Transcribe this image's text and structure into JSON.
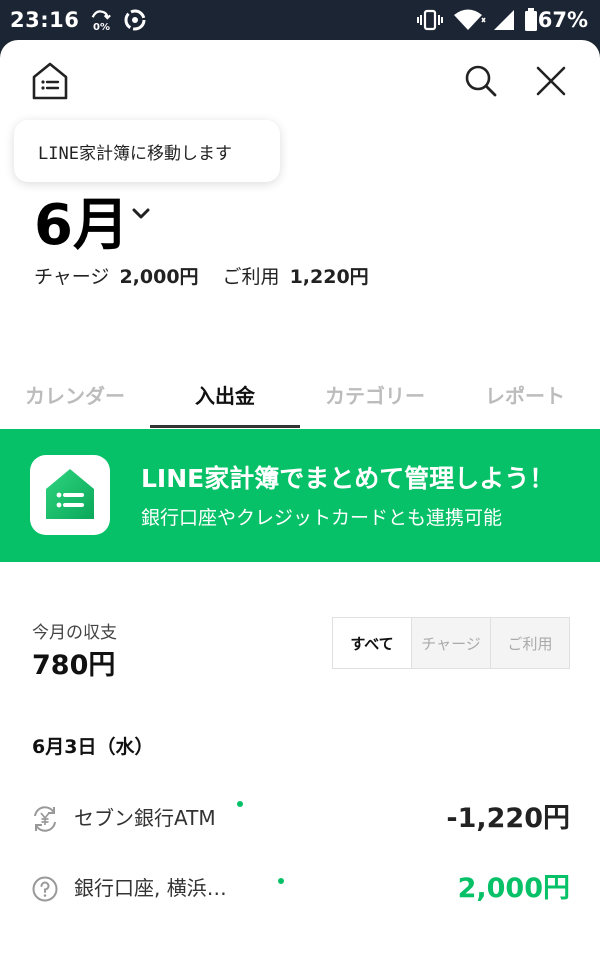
{
  "status_bar": {
    "time": "23:16",
    "data_saver": "0%",
    "battery_percent": "67%"
  },
  "header": {
    "tooltip": "LINE家計簿に移動します",
    "month": "6月",
    "summary": {
      "charge_label": "チャージ",
      "charge_value": "2,000円",
      "usage_label": "ご利用",
      "usage_value": "1,220円"
    }
  },
  "tabs": [
    {
      "label": "カレンダー",
      "active": false
    },
    {
      "label": "入出金",
      "active": true
    },
    {
      "label": "カテゴリー",
      "active": false
    },
    {
      "label": "レポート",
      "active": false
    }
  ],
  "banner": {
    "title": "LINE家計簿でまとめて管理しよう！",
    "subtitle": "銀行口座やクレジットカードとも連携可能"
  },
  "balance": {
    "label": "今月の収支",
    "value": "780円"
  },
  "filter": {
    "options": [
      "すべて",
      "チャージ",
      "ご利用"
    ],
    "selected": "すべて"
  },
  "transactions": {
    "date": "6月3日（水）",
    "items": [
      {
        "icon": "yen-exchange-icon",
        "name": "セブン銀行ATM",
        "amount": "-1,220円",
        "type": "usage"
      },
      {
        "icon": "question-circle-icon",
        "name": "銀行口座, 横浜…",
        "amount": "2,000円",
        "type": "charge"
      }
    ]
  },
  "colors": {
    "brand_green": "#06c167",
    "status_bar": "#1c2533"
  }
}
